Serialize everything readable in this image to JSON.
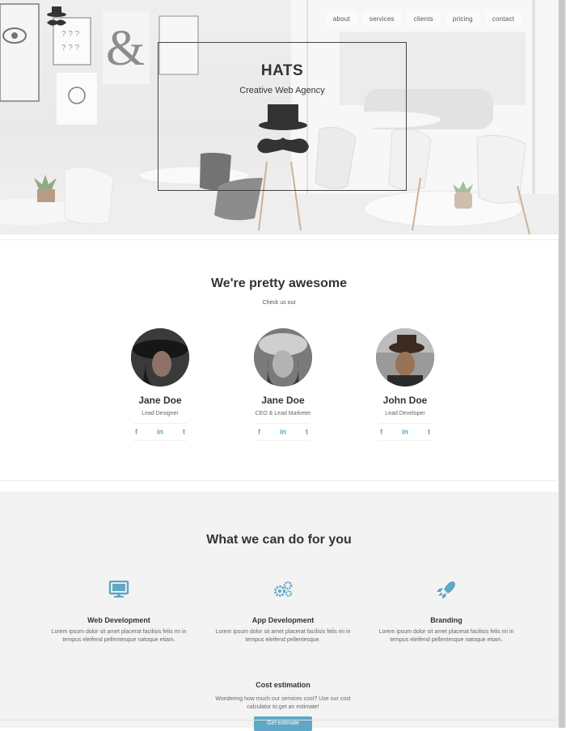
{
  "nav": {
    "items": [
      "about",
      "services",
      "clients",
      "pricing",
      "contact"
    ]
  },
  "hero": {
    "title": "HATS",
    "subtitle": "Creative Web Agency"
  },
  "team": {
    "title": "We're pretty awesome",
    "subtitle": "Check us out",
    "members": [
      {
        "name": "Jane Doe",
        "role": "Lead Designer"
      },
      {
        "name": "Jane Doe",
        "role": "CEO & Lead Marketer"
      },
      {
        "name": "John Doe",
        "role": "Lead Developer"
      }
    ],
    "social_icons": [
      "f",
      "in",
      "t"
    ]
  },
  "services": {
    "title": "What we can do for you",
    "items": [
      {
        "icon": "monitor-icon",
        "title": "Web Development",
        "text": "Lorem ipsum dolor sit amet placerat facilisis felis mi in tempus eleifend pellentesque natoque etiam."
      },
      {
        "icon": "gears-icon",
        "title": "App Development",
        "text": "Lorem ipsum dolor sit amet placerat facilisis felis mi in tempus eleifend pellentesque."
      },
      {
        "icon": "rocket-icon",
        "title": "Branding",
        "text": "Lorem ipsum dolor sit amet placerat facilisis felis mi in tempus eleifend pellentesque natoque etiam."
      }
    ],
    "estimate": {
      "title": "Cost estimation",
      "text": "Wondering how much our services cost? Use our cost calculator to get an estimate!",
      "button": "Get estimate"
    }
  },
  "colors": {
    "accent": "#5ea7c7",
    "text": "#333333",
    "section_bg": "#f3f3f3"
  }
}
